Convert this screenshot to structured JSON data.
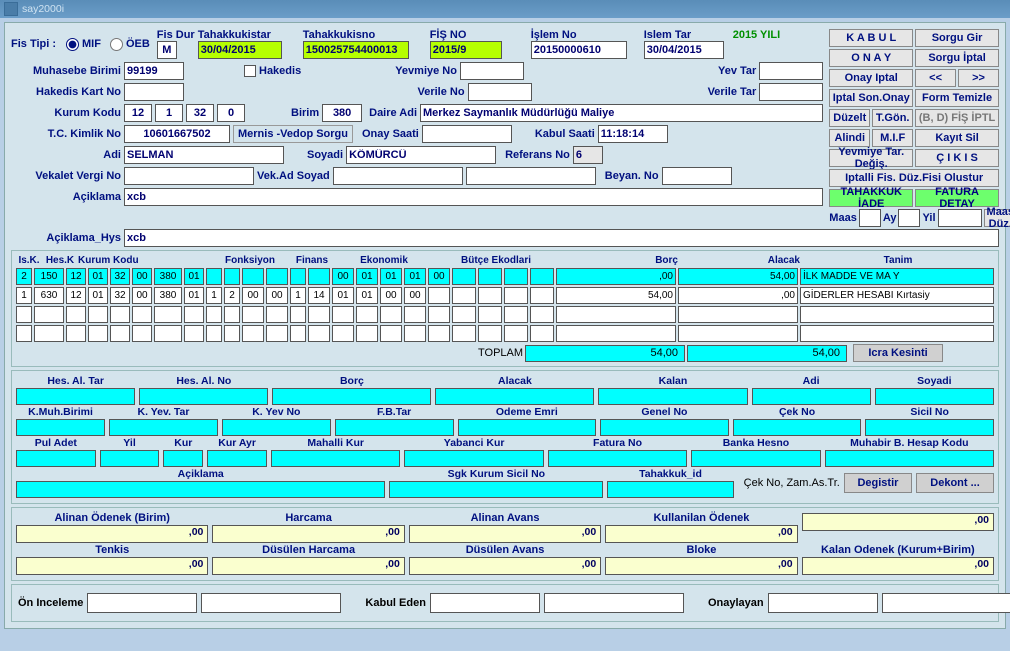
{
  "title": "say2000i",
  "year": "2015 YILI",
  "fisTipi": {
    "label": "Fis Tipi :",
    "mif": "MIF",
    "oeb": "ÖEB"
  },
  "header": {
    "fisDur": {
      "label": "Fis Dur",
      "val": "M"
    },
    "tahakkukistar": {
      "label": "Tahakkukistar",
      "val": "30/04/2015"
    },
    "tahakkukisno": {
      "label": "Tahakkukisno",
      "val": "150025754400013"
    },
    "fisNo": {
      "label": "FİŞ NO",
      "val": "2015/9"
    },
    "islemNo": {
      "label": "İşlem No",
      "val": "20150000610"
    },
    "islemTar": {
      "label": "Islem Tar",
      "val": "30/04/2015"
    },
    "muhasebeBirimi": {
      "label": "Muhasebe Birimi",
      "val": "99199"
    },
    "hakedis": "Hakedis",
    "yevmiyeNo": {
      "label": "Yevmiye No"
    },
    "yevTar": {
      "label": "Yev Tar"
    },
    "hakedisKartNo": {
      "label": "Hakedis Kart No"
    },
    "verileNo": {
      "label": "Verile No"
    },
    "verileTar": {
      "label": "Verile Tar"
    },
    "kurumKodu": {
      "label": "Kurum Kodu",
      "v1": "12",
      "v2": "1",
      "v3": "32",
      "v4": "0"
    },
    "birim": {
      "label": "Birim",
      "val": "380"
    },
    "daireAdi": {
      "label": "Daire Adi",
      "val": "Merkez Saymanlık Müdürlüğü Maliye"
    },
    "tckimlik": {
      "label": "T.C. Kimlik No",
      "val": "10601667502"
    },
    "mernis": "Mernis -Vedop Sorgu",
    "onaySaati": {
      "label": "Onay Saati"
    },
    "kabulSaati": {
      "label": "Kabul Saati",
      "val": "11:18:14"
    },
    "adi": {
      "label": "Adi",
      "val": "SELMAN"
    },
    "soyadi": {
      "label": "Soyadi",
      "val": "KÖMÜRCÜ"
    },
    "referansNo": {
      "label": "Referans No",
      "val": "6"
    },
    "vekaletVergiNo": {
      "label": "Vekalet Vergi No"
    },
    "vekAdSoyad": {
      "label": "Vek.Ad Soyad"
    },
    "beyanNo": {
      "label": "Beyan. No"
    },
    "aciklama": {
      "label": "Açiklama",
      "val": "xcb"
    },
    "aciklamaHys": {
      "label": "Açiklama_Hys",
      "val": "xcb"
    },
    "maas": "Maas",
    "ay": "Ay",
    "yil": "Yil"
  },
  "buttons": {
    "kabul": "K A B U L",
    "onay": "O N A Y",
    "onayIptal": "Onay Iptal",
    "iptalSonOnay": "Iptal Son.Onay",
    "duzelt": "Düzelt",
    "tgon": "T.Gön.",
    "alindi": "Alindi",
    "mif": "M.I.F",
    "yevTarDegis": "Yevmiye Tar. Değiş.",
    "sorguGir": "Sorgu Gir",
    "sorguIptal": "Sorgu İptal",
    "prev": "<<",
    "next": ">>",
    "formTemizle": "Form Temizle",
    "bdfis": "(B, D) FİŞ İPTL",
    "kayitSil": "Kayıt Sil",
    "cikis": "Ç I K I S",
    "iptalliFis": "Iptalli Fis. Düz.Fisi Olustur",
    "tahakkukIade": "TAHAKKUK  İADE",
    "faturaDetay": "FATURA  DETAY",
    "maasDuz": "Maas Düz.",
    "icraKesinti": "Icra Kesinti",
    "degistir": "Degistir",
    "dekont": "Dekont ...",
    "cekNo": "Çek No, Zam.As.Tr."
  },
  "gridHeaders": {
    "isk": "Is.K.",
    "hesk": "Hes.K",
    "kurum": "Kurum Kodu",
    "fonksiyon": "Fonksiyon",
    "finans": "Finans",
    "ekonomik": "Ekonomik",
    "butce": "Bütçe  Ekodlari",
    "borc": "Borç",
    "alacak": "Alacak",
    "tanim": "Tanim",
    "toplam": "TOPLAM"
  },
  "gridRows": [
    {
      "cyan": true,
      "c": [
        "2",
        "150",
        "12",
        "01",
        "32",
        "00",
        "380",
        "01",
        "",
        "",
        "",
        "",
        "",
        "",
        "00",
        "01",
        "01",
        "01",
        "00",
        "",
        "",
        "",
        ""
      ],
      "borc": ",00",
      "alacak": "54,00",
      "tanim": "İLK MADDE VE MA Y"
    },
    {
      "cyan": false,
      "c": [
        "1",
        "630",
        "12",
        "01",
        "32",
        "00",
        "380",
        "01",
        "1",
        "2",
        "00",
        "00",
        "1",
        "14",
        "01",
        "01",
        "00",
        "00",
        "",
        "",
        "",
        "",
        ""
      ],
      "borc": "54,00",
      "alacak": ",00",
      "tanim": "GİDERLER HESABI Kırtasiy"
    }
  ],
  "totals": {
    "borc": "54,00",
    "alacak": "54,00"
  },
  "detailHeaders": {
    "r1": [
      "Hes. Al. Tar",
      "Hes. Al. No",
      "Borç",
      "Alacak",
      "Kalan",
      "Adi",
      "Soyadi"
    ],
    "r2": [
      "K.Muh.Birimi",
      "K. Yev. Tar",
      "K. Yev No",
      "F.B.Tar",
      "Odeme Emri",
      "Genel No",
      "Çek No",
      "Sicil No"
    ],
    "r3": [
      "Pul Adet",
      "Yil",
      "Kur",
      "Kur Ayr",
      "Mahalli Kur",
      "Yabanci   Kur",
      "Fatura No",
      "Banka Hesno",
      "Muhabir B. Hesap Kodu"
    ],
    "r4": [
      "Açiklama",
      "Sgk Kurum Sicil No",
      "Tahakkuk_id"
    ]
  },
  "budget": {
    "r1": [
      "Alinan Ödenek (Birim)",
      "Harcama",
      "Alinan Avans",
      "Kullanilan  Ödenek",
      ""
    ],
    "r2": [
      "Tenkis",
      "Düsülen Harcama",
      "Düsülen Avans",
      "Bloke",
      "Kalan Odenek (Kurum+Birim)"
    ],
    "val": ",00"
  },
  "sign": {
    "on": "Ön Inceleme",
    "kabul": "Kabul Eden",
    "onay": "Onaylayan"
  }
}
